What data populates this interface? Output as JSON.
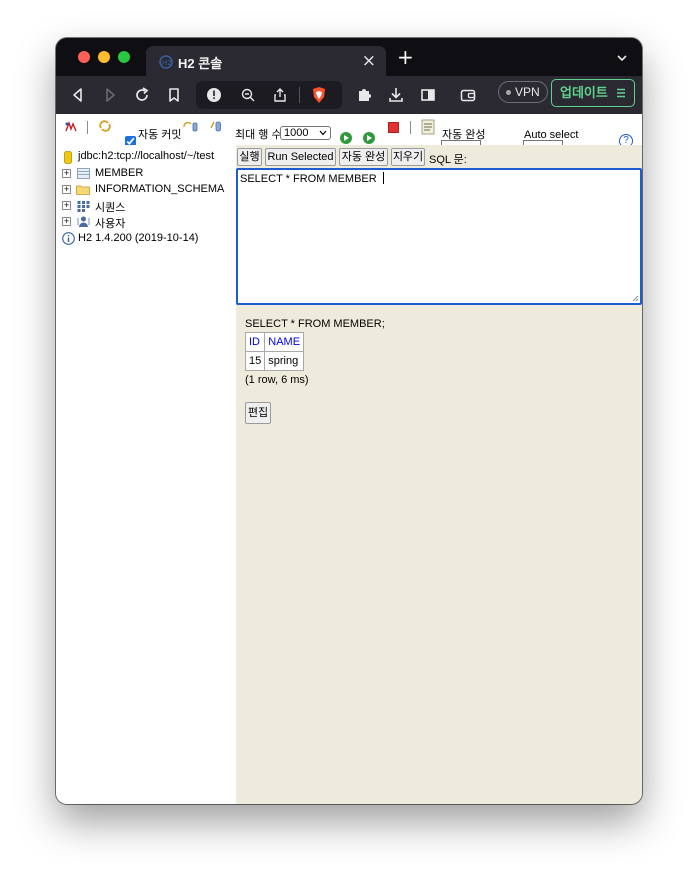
{
  "browser": {
    "tab_title": "H2 콘솔",
    "tab_close": "×",
    "new_tab": "+",
    "vpn_label": "VPN",
    "update_label": "업데이트"
  },
  "h2_toolbar": {
    "auto_commit_label": "자동 커밋",
    "max_rows_label": "최대 행 수",
    "max_rows_value": "1000",
    "auto_complete_label": "자동 완성",
    "auto_select_label": "Auto select",
    "help": "?"
  },
  "tree": {
    "connection": "jdbc:h2:tcp://localhost/~/test",
    "items": [
      {
        "label": "MEMBER"
      },
      {
        "label": "INFORMATION_SCHEMA"
      },
      {
        "label": "시퀀스"
      },
      {
        "label": "사용자"
      }
    ],
    "version": "H2 1.4.200 (2019-10-14)"
  },
  "query": {
    "run_button": "실행",
    "run_selected_button": "Run Selected",
    "auto_complete_button": "자동 완성",
    "clear_button": "지우기",
    "sql_label": "SQL 문:",
    "sql_text": "SELECT * FROM MEMBER "
  },
  "result": {
    "executed_sql": "SELECT * FROM MEMBER;",
    "columns": [
      "ID",
      "NAME"
    ],
    "rows": [
      [
        "15",
        "spring"
      ]
    ],
    "meta": "(1 row, 6 ms)",
    "edit_button": "편집"
  },
  "colors": {
    "editor_border": "#1f5bd1",
    "main_bg": "#efebdc",
    "update_green": "#5fd38d"
  }
}
